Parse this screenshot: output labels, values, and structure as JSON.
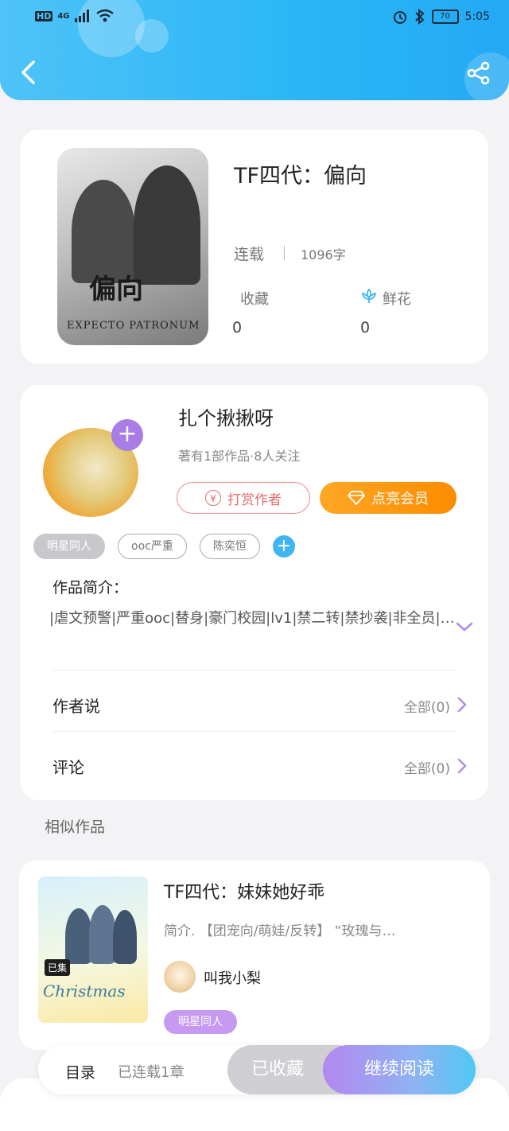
{
  "status_bar": {
    "network": "HD",
    "signal": "4G",
    "battery": "70",
    "time": "5:05"
  },
  "book": {
    "title": "TF四代：偏向",
    "cover_title": "偏向",
    "cover_subtitle": "EXPECTO PATRONUM",
    "serial_status": "连载",
    "word_count": "1096字",
    "collect_label": "收藏",
    "collect_count": "0",
    "flower_label": "鲜花",
    "flower_count": "0"
  },
  "author": {
    "name": "扎个揪揪呀",
    "meta": "著有1部作品·8人关注",
    "reward_label": "打赏作者",
    "reward_icon_text": "¥",
    "vip_label": "点亮会员",
    "tags": [
      "明星同人",
      "ooc严重",
      "陈奕恒"
    ]
  },
  "intro": {
    "label": "作品简介：",
    "text": "|虐文预警|严重ooc|替身|豪门校园|lv1|禁二转|禁抄袭|非全员|…"
  },
  "rows": {
    "author_says_label": "作者说",
    "author_says_count": "全部(0)",
    "comments_label": "评论",
    "comments_count": "全部(0)"
  },
  "similar": {
    "heading": "相似作品",
    "items": [
      {
        "title": "TF四代：妹妹她好乖",
        "desc": "简介. 【团宠向/萌娃/反转】 “玫瑰与…",
        "author": "叫我小梨",
        "tag": "明星同人",
        "cover_text": "Christmas",
        "cover_badge": "已集"
      }
    ]
  },
  "bottom_bar": {
    "toc_label": "目录",
    "serial_count": "已连载1章",
    "collected_label": "已收藏",
    "read_label": "继续阅读"
  },
  "colors": {
    "header_blue": "#29b6f6",
    "vip_orange": "#fb8c00",
    "reward_red": "#e86e6e",
    "tag_purple": "#c59af0",
    "accent_blue": "#3fb5f3"
  },
  "icons": [
    "back-icon",
    "share-icon",
    "flower-icon",
    "plus-icon",
    "chevron-down-icon",
    "chevron-right-icon",
    "diamond-icon",
    "yen-icon"
  ]
}
